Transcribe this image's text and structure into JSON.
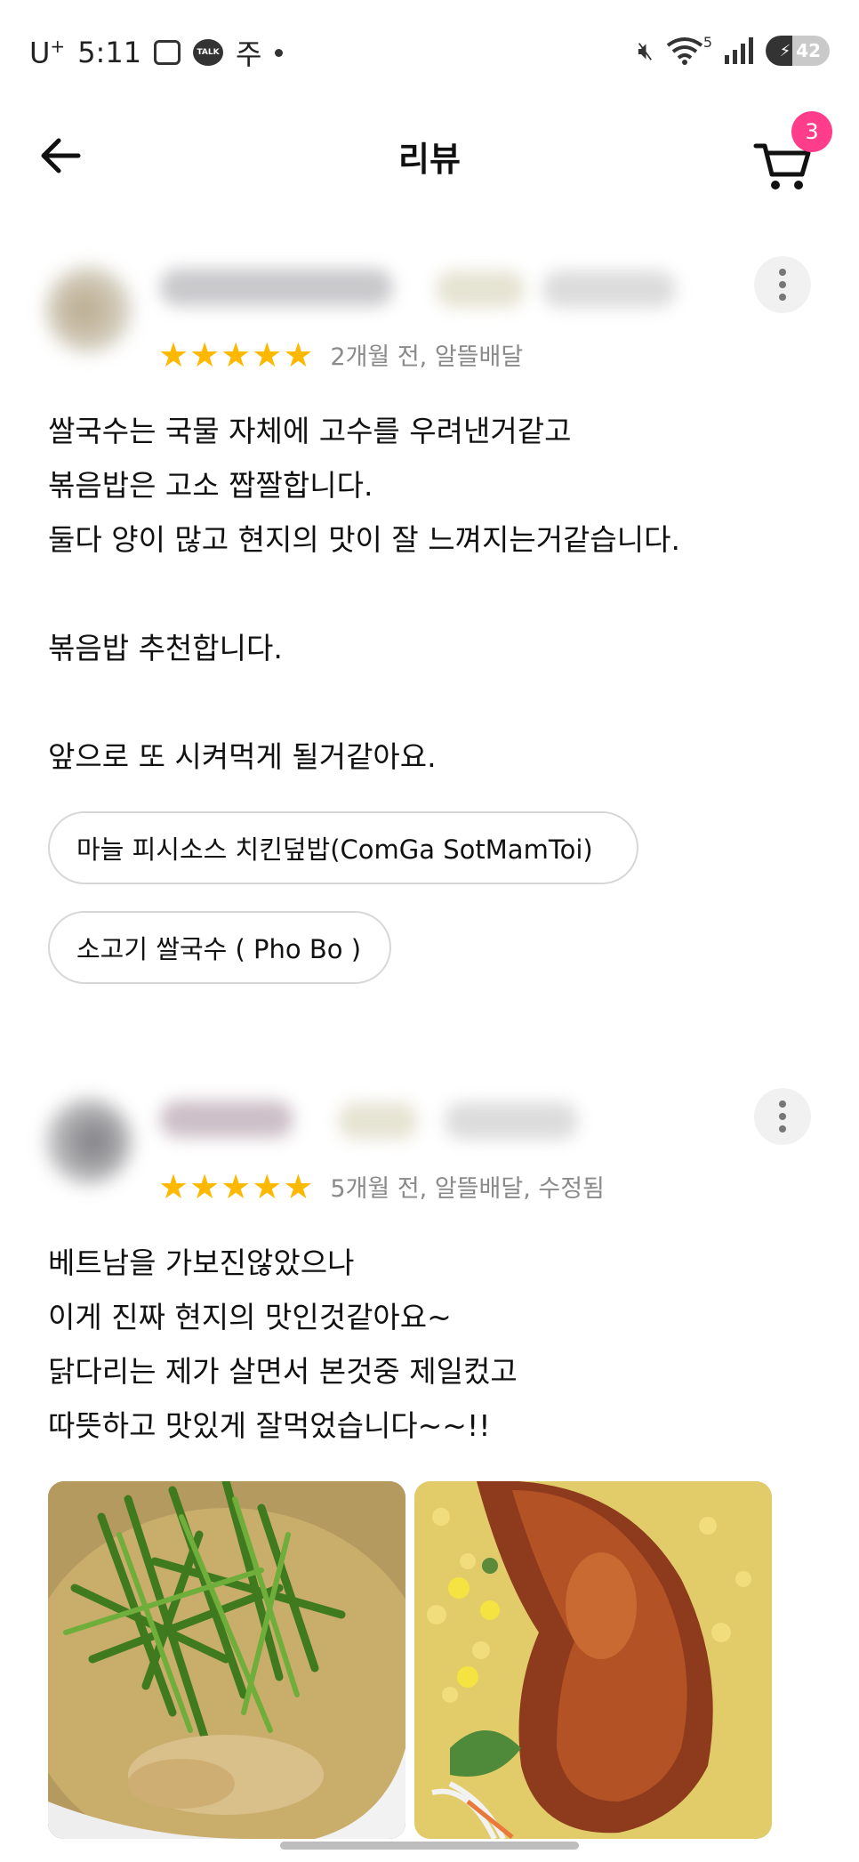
{
  "status_bar": {
    "carrier": "U",
    "carrier_sup": "+",
    "time": "5:11",
    "talk_label": "TALK",
    "app_char": "주",
    "signal_tag": "5",
    "battery": "42"
  },
  "header": {
    "title": "리뷰",
    "cart_count": "3"
  },
  "colors": {
    "star": "#ffb800",
    "badge": "#ff3d8b",
    "meta_text": "#8a8a8a",
    "chip_border": "#d7d7d7"
  },
  "reviews": [
    {
      "rating": 5,
      "meta": "2개월 전, 알뜰배달",
      "text": "쌀국수는 국물 자체에 고수를 우려낸거같고\n볶음밥은 고소 짭짤합니다.\n둘다 양이 많고 현지의 맛이 잘 느껴지는거같습니다.\n\n볶음밥 추천합니다.\n\n앞으로 또 시켜먹게 될거같아요.",
      "chips": [
        "마늘 피시소스 치킨덮밥(ComGa SotMamToi)",
        "소고기 쌀국수 ( Pho Bo )"
      ]
    },
    {
      "rating": 5,
      "meta": "5개월 전, 알뜰배달, 수정됨",
      "text": "베트남을 가보진않았으나\n이게 진짜 현지의 맛인것같아요~\n닭다리는 제가 살면서 본것중 제일컸고\n따뜻하고 맛있게 잘먹었습니다~~!!",
      "photos": [
        "vegetable-soup-photo",
        "roast-chicken-leg-photo"
      ]
    }
  ]
}
